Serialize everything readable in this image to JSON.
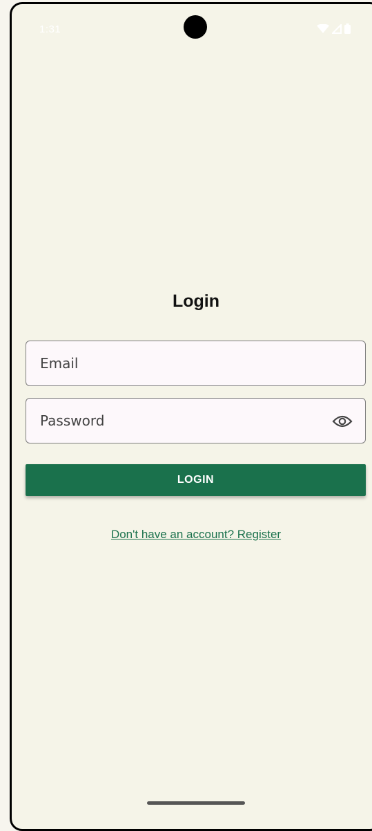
{
  "status_bar": {
    "time": "1:31",
    "icons": [
      "wifi-icon",
      "signal-icon",
      "battery-icon"
    ]
  },
  "screen": {
    "title": "Login",
    "email": {
      "placeholder": "Email",
      "value": ""
    },
    "password": {
      "placeholder": "Password",
      "value": "",
      "toggle_icon": "eye-icon"
    },
    "login_label": "LOGIN",
    "register_link": "Don't have an account? Register"
  },
  "colors": {
    "background": "#f5f4e8",
    "primary": "#1a714c",
    "field_background": "#fdf8fb",
    "field_border": "#7b7b7b"
  }
}
